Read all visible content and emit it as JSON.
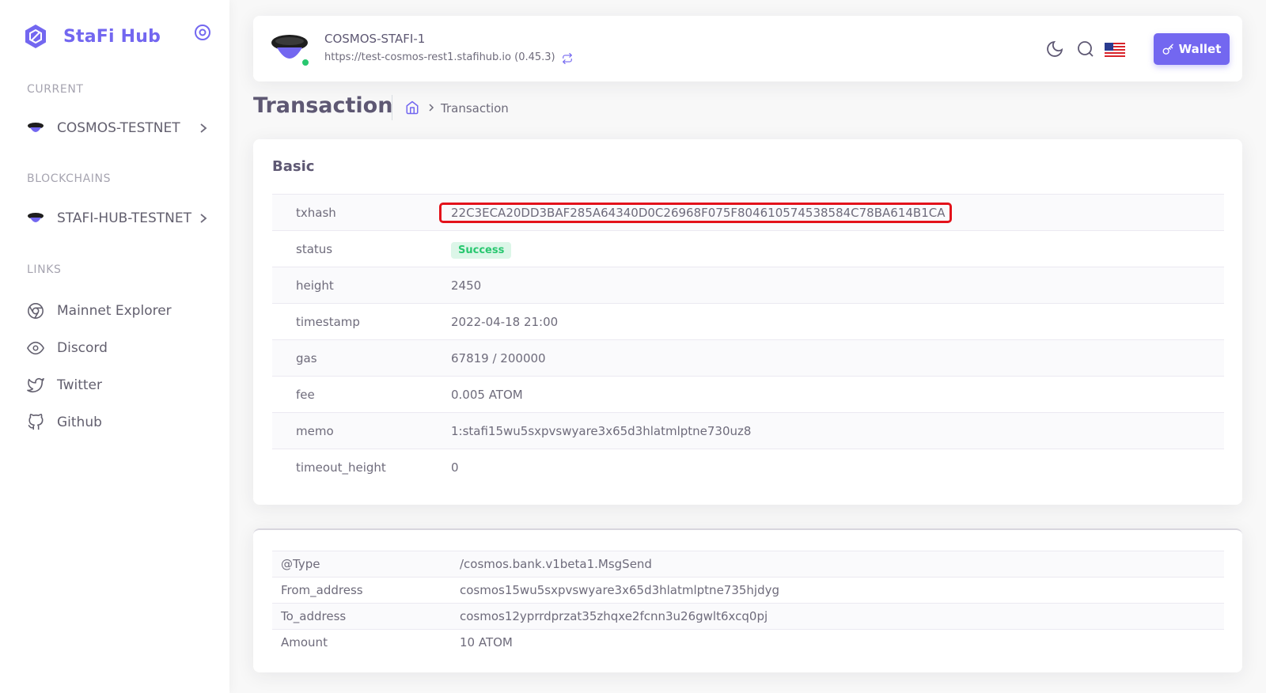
{
  "sidebar": {
    "brand": "StaFi Hub",
    "sections": {
      "current": "CURRENT",
      "blockchains": "BLOCKCHAINS",
      "links": "LINKS"
    },
    "current_chain": "COSMOS-TESTNET",
    "blockchain_item": "STAFI-HUB-TESTNET",
    "links": [
      {
        "label": "Mainnet Explorer",
        "icon": "chrome-icon"
      },
      {
        "label": "Discord",
        "icon": "eye-icon"
      },
      {
        "label": "Twitter",
        "icon": "twitter-icon"
      },
      {
        "label": "Github",
        "icon": "github-icon"
      }
    ]
  },
  "navbar": {
    "chain_name": "COSMOS-STAFI-1",
    "chain_url": "https://test-cosmos-rest1.stafihub.io (0.45.3)",
    "wallet_label": "Wallet",
    "icons": [
      "moon-icon",
      "search-icon",
      "us-flag-icon"
    ]
  },
  "breadcrumb": {
    "page_title": "Transaction",
    "current": "Transaction"
  },
  "basic": {
    "title": "Basic",
    "rows": [
      {
        "key": "txhash",
        "value": "22C3ECA20DD3BAF285A64340D0C26968F075F804610574538584C78BA614B1CA"
      },
      {
        "key": "status",
        "value": "Success"
      },
      {
        "key": "height",
        "value": "2450"
      },
      {
        "key": "timestamp",
        "value": "2022-04-18 21:00"
      },
      {
        "key": "gas",
        "value": "67819 / 200000"
      },
      {
        "key": "fee",
        "value": "0.005 ATOM"
      },
      {
        "key": "memo",
        "value": "1:stafi15wu5sxpvswyare3x65d3hlatmlptne730uz8"
      },
      {
        "key": "timeout_height",
        "value": "0"
      }
    ]
  },
  "message": {
    "rows": [
      {
        "key": "@Type",
        "value": "/cosmos.bank.v1beta1.MsgSend"
      },
      {
        "key": "From_address",
        "value": "cosmos15wu5sxpvswyare3x65d3hlatmlptne735hjdyg"
      },
      {
        "key": "To_address",
        "value": "cosmos12yprrdprzat35zhqxe2fcnn3u26gwlt6xcq0pj"
      },
      {
        "key": "Amount",
        "value": "10 ATOM"
      }
    ]
  },
  "colors": {
    "accent": "#7367f0",
    "success": "#28c76f",
    "highlight_border": "#e3121b"
  }
}
